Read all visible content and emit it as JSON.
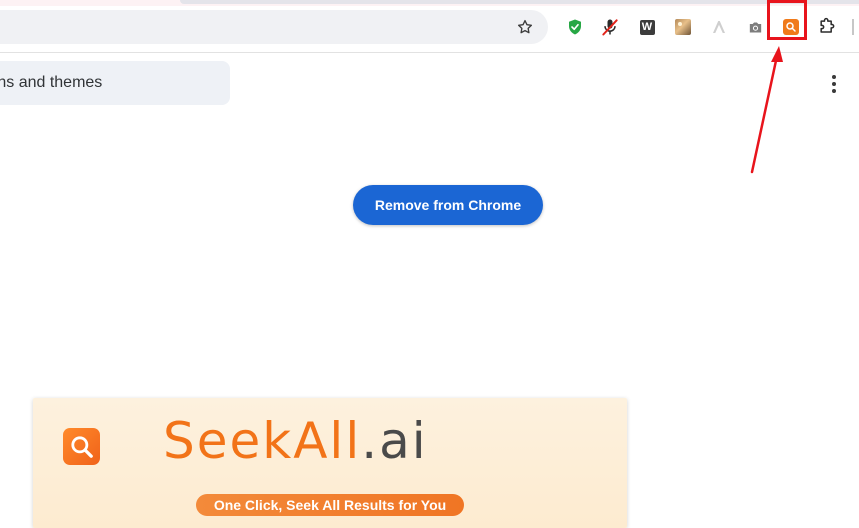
{
  "toolbar": {
    "extensions": [
      {
        "name": "shield-check-extension"
      },
      {
        "name": "mic-off-extension"
      },
      {
        "name": "w-extension",
        "label": "W"
      },
      {
        "name": "photo-extension"
      },
      {
        "name": "arrow-extension"
      },
      {
        "name": "camera-extension"
      },
      {
        "name": "seekall-extension"
      },
      {
        "name": "puzzle-extensions-menu"
      }
    ],
    "highlight_color": "#e8141c"
  },
  "page": {
    "back_link_text": "nsions and themes",
    "remove_button_label": "Remove from Chrome",
    "accent_color": "#1b66d4"
  },
  "banner": {
    "brand_seek": "SeekAll",
    "brand_tld": ".ai",
    "slogan": "One Click, Seek All Results for You",
    "brand_color": "#f27318"
  }
}
